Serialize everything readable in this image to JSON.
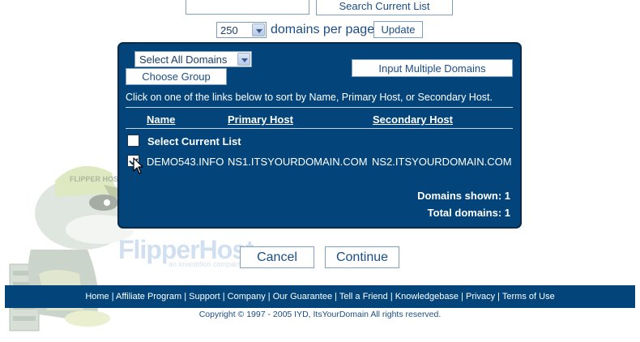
{
  "search": {
    "button_label": "Search Current List",
    "input_value": ""
  },
  "pagination": {
    "per_page_value": "250",
    "per_page_label": "domains per page",
    "update_label": "Update"
  },
  "panel": {
    "domain_select_value": "Select All Domains",
    "choose_group_label": "Choose Group",
    "input_multiple_label": "Input Multiple Domains",
    "instruction": "Click on one of the links below to sort by Name, Primary Host, or Secondary Host.",
    "columns": {
      "name": "Name",
      "primary": "Primary Host",
      "secondary": "Secondary Host"
    },
    "select_current_label": "Select Current List",
    "rows": [
      {
        "name": "DEMO543.INFO",
        "primary": "NS1.ITSYOURDOMAIN.COM",
        "secondary": "NS2.ITSYOURDOMAIN.COM",
        "checked": true
      }
    ],
    "domains_shown": "Domains shown: 1",
    "total_domains": "Total domains: 1"
  },
  "actions": {
    "cancel_label": "Cancel",
    "continue_label": "Continue"
  },
  "logo": {
    "text": "FlipperHost",
    "tagline": "an investition company"
  },
  "mascot_cap_text": "FLIPPER HOST",
  "footer": {
    "links": [
      "Home",
      "Affiliate Program",
      "Support",
      "Company",
      "Our Guarantee",
      "Tell a Friend",
      "Knowledgebase",
      "Privacy",
      "Terms of Use"
    ],
    "separator": "|",
    "copyright": "Copyright © 1997 - 2005 IYD, ItsYourDomain All rights reserved."
  },
  "colors": {
    "panel_bg": "#03457a",
    "button_text": "#1b4e86",
    "page_bg": "#ffffff"
  }
}
